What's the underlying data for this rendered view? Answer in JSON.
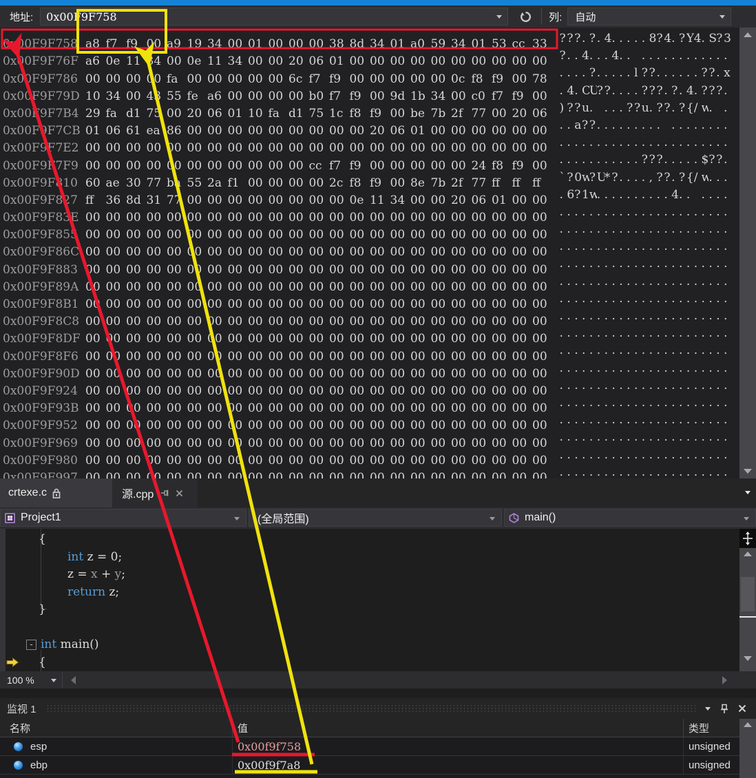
{
  "colors": {
    "accent_blue": "#1583d5",
    "annotation_red": "#e8182c",
    "annotation_yellow": "#f0e20c",
    "changed_value": "#e79c9c",
    "keyword_blue": "#569cd6"
  },
  "memory_toolbar": {
    "address_label": "地址:",
    "address_value": "0x00F9F758",
    "columns_label": "列:",
    "columns_value": "自动"
  },
  "memory": {
    "cursor": {
      "row": 8,
      "byte": 20
    },
    "rows": [
      {
        "addr": "0x00F9F758",
        "bytes": "a8 f7 f9 00 a9 19 34 00 01 00 00 00 38 8d 34 01 a0 59 34 01 53 cc 33",
        "ascii": "???.?.4.....8?4.?Y4.S?3"
      },
      {
        "addr": "0x00F9F76F",
        "bytes": "a6 0e 11 34 00 0e 11 34 00 00 20 06 01 00 00 00 00 00 00 00 00 00 00",
        "ascii": "?..4...4.. ............"
      },
      {
        "addr": "0x00F9F786",
        "bytes": "00 00 00 00 fa 00 00 00 00 00 6c f7 f9 00 00 00 00 00 0c f8 f9 00 78",
        "ascii": "....?.....l??......??.x"
      },
      {
        "addr": "0x00F9F79D",
        "bytes": "10 34 00 43 55 fe a6 00 00 00 00 b0 f7 f9 00 9d 1b 34 00 c0 f7 f9 00",
        "ascii": ".4.CU??....???.?.4.???."
      },
      {
        "addr": "0x00F9F7B4",
        "bytes": "29 fa d1 75 00 20 06 01 10 fa d1 75 1c f8 f9 00 be 7b 2f 77 00 20 06",
        "ascii": ")??u. ...??u.??.?{/w. ."
      },
      {
        "addr": "0x00F9F7CB",
        "bytes": "01 06 61 ea 86 00 00 00 00 00 00 00 00 00 20 06 01 00 00 00 00 00 00",
        "ascii": "..a??......... ........"
      },
      {
        "addr": "0x00F9F7E2",
        "bytes": "00 00 00 00 00 00 00 00 00 00 00 00 00 00 00 00 00 00 00 00 00 00 00",
        "ascii": "......................."
      },
      {
        "addr": "0x00F9F7F9",
        "bytes": "00 00 00 00 00 00 00 00 00 00 00 cc f7 f9 00 00 00 00 00 24 f8 f9 00",
        "ascii": "...........???.....$??."
      },
      {
        "addr": "0x00F9F810",
        "bytes": "60 ae 30 77 ba 55 2a f1 00 00 00 00 2c f8 f9 00 8e 7b 2f 77 ff ff ff",
        "ascii": "`?0w?U*?....,??.?{/w..."
      },
      {
        "addr": "0x00F9F827",
        "bytes": "ff 36 8d 31 77 00 00 00 00 00 00 00 00 0e 11 34 00 00 20 06 01 00 00",
        "ascii": ".6?1w..........4.. ...."
      },
      {
        "addr": "0x00F9F83E",
        "bytes": "00 00 00 00 00 00 00 00 00 00 00 00 00 00 00 00 00 00 00 00 00 00 00",
        "ascii": "......................."
      },
      {
        "addr": "0x00F9F855",
        "bytes": "00 00 00 00 00 00 00 00 00 00 00 00 00 00 00 00 00 00 00 00 00 00 00",
        "ascii": "......................."
      },
      {
        "addr": "0x00F9F86C",
        "bytes": "00 00 00 00 00 00 00 00 00 00 00 00 00 00 00 00 00 00 00 00 00 00 00",
        "ascii": "......................."
      },
      {
        "addr": "0x00F9F883",
        "bytes": "00 00 00 00 00 00 00 00 00 00 00 00 00 00 00 00 00 00 00 00 00 00 00",
        "ascii": "......................."
      },
      {
        "addr": "0x00F9F89A",
        "bytes": "00 00 00 00 00 00 00 00 00 00 00 00 00 00 00 00 00 00 00 00 00 00 00",
        "ascii": "......................."
      },
      {
        "addr": "0x00F9F8B1",
        "bytes": "00 00 00 00 00 00 00 00 00 00 00 00 00 00 00 00 00 00 00 00 00 00 00",
        "ascii": "......................."
      },
      {
        "addr": "0x00F9F8C8",
        "bytes": "00 00 00 00 00 00 00 00 00 00 00 00 00 00 00 00 00 00 00 00 00 00 00",
        "ascii": "......................."
      },
      {
        "addr": "0x00F9F8DF",
        "bytes": "00 00 00 00 00 00 00 00 00 00 00 00 00 00 00 00 00 00 00 00 00 00 00",
        "ascii": "......................."
      },
      {
        "addr": "0x00F9F8F6",
        "bytes": "00 00 00 00 00 00 00 00 00 00 00 00 00 00 00 00 00 00 00 00 00 00 00",
        "ascii": "......................."
      },
      {
        "addr": "0x00F9F90D",
        "bytes": "00 00 00 00 00 00 00 00 00 00 00 00 00 00 00 00 00 00 00 00 00 00 00",
        "ascii": "......................."
      },
      {
        "addr": "0x00F9F924",
        "bytes": "00 00 00 00 00 00 00 00 00 00 00 00 00 00 00 00 00 00 00 00 00 00 00",
        "ascii": "......................."
      },
      {
        "addr": "0x00F9F93B",
        "bytes": "00 00 00 00 00 00 00 00 00 00 00 00 00 00 00 00 00 00 00 00 00 00 00",
        "ascii": "......................."
      },
      {
        "addr": "0x00F9F952",
        "bytes": "00 00 00 00 00 00 00 00 00 00 00 00 00 00 00 00 00 00 00 00 00 00 00",
        "ascii": "......................."
      },
      {
        "addr": "0x00F9F969",
        "bytes": "00 00 00 00 00 00 00 00 00 00 00 00 00 00 00 00 00 00 00 00 00 00 00",
        "ascii": "......................."
      },
      {
        "addr": "0x00F9F980",
        "bytes": "00 00 00 00 00 00 00 00 00 00 00 00 00 00 00 00 00 00 00 00 00 00 00",
        "ascii": "......................."
      },
      {
        "addr": "0x00F9F997",
        "bytes": "00 00 00 00 00 00 00 00 00 00 00 00 00 00 00 00 00 00 00 00 00 00 00",
        "ascii": "......................."
      }
    ]
  },
  "tabs": {
    "items": [
      {
        "label": "crtexe.c",
        "icon": "lock"
      },
      {
        "label": "源.cpp",
        "icons": [
          "pin",
          "close"
        ]
      }
    ]
  },
  "navbar": {
    "project": "Project1",
    "scope": "(全局范围)",
    "method": "main()"
  },
  "code": {
    "lines": [
      {
        "ind": 18,
        "tokens": [
          {
            "t": "{",
            "c": "p"
          }
        ]
      },
      {
        "ind": 60,
        "tokens": [
          {
            "t": "int",
            "c": "k"
          },
          {
            "t": " z = 0;",
            "c": "p"
          }
        ]
      },
      {
        "ind": 60,
        "tokens": [
          {
            "t": "z = ",
            "c": "p"
          },
          {
            "t": "x",
            "c": "g"
          },
          {
            "t": " + ",
            "c": "p"
          },
          {
            "t": "y",
            "c": "g"
          },
          {
            "t": ";",
            "c": "p"
          }
        ]
      },
      {
        "ind": 60,
        "tokens": [
          {
            "t": "return",
            "c": "k"
          },
          {
            "t": " z;",
            "c": "p"
          }
        ]
      },
      {
        "ind": 18,
        "tokens": [
          {
            "t": "}",
            "c": "p"
          }
        ]
      },
      {
        "ind": 0,
        "tokens": []
      },
      {
        "ind": 0,
        "collapse": true,
        "tokens": [
          {
            "t": "int",
            "c": "k"
          },
          {
            "t": " main()",
            "c": "p"
          }
        ]
      },
      {
        "ind": 18,
        "arrow": true,
        "tokens": [
          {
            "t": "{",
            "c": "p"
          }
        ]
      }
    ]
  },
  "editor_status": {
    "zoom_level": "100 %"
  },
  "watch": {
    "title": "监视 1",
    "columns": [
      "名称",
      "值",
      "类型"
    ],
    "rows": [
      {
        "name": "esp",
        "value": "0x00f9f758",
        "type": "unsigned",
        "changed": true
      },
      {
        "name": "ebp",
        "value": "0x00f9f7a8",
        "type": "unsigned",
        "changed": false
      }
    ]
  }
}
